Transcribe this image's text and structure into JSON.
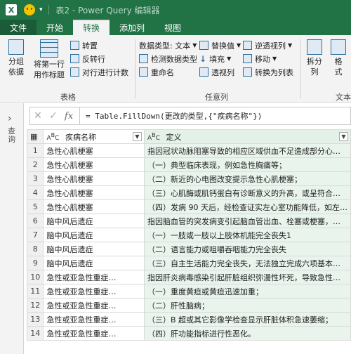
{
  "titlebar": {
    "logo": "X",
    "title": "表2 - Power Query 编辑器"
  },
  "tabs": [
    "文件",
    "开始",
    "转换",
    "添加列",
    "视图"
  ],
  "ribbon": {
    "group_table": {
      "label": "表格",
      "group_by": "分组\n依据",
      "first_row_header": "将第一行\n用作标题",
      "transpose": "转置",
      "reverse_rows": "反转行",
      "count_rows": "对行进行计数"
    },
    "group_anycol": {
      "label": "任意列",
      "data_type": "数据类型: 文本",
      "detect_type": "检测数据类型",
      "rename": "重命名",
      "replace_values": "替换值",
      "fill": "填充",
      "pivot": "透视列",
      "unpivot": "逆透视列",
      "move": "移动",
      "to_list": "转换为列表"
    },
    "split": "拆分\n列",
    "format": "格\n式",
    "text_label": "文本"
  },
  "leftpane": {
    "label": "查询"
  },
  "formula": {
    "text": "= Table.FillDown(更改的类型,{\"疾病名称\"})"
  },
  "columns": [
    "疾病名称",
    "定义"
  ],
  "rows": [
    [
      "1",
      "急性心肌梗塞",
      "指因冠状动脉阻塞导致的相应区域供血不足造成部分心…"
    ],
    [
      "2",
      "急性心肌梗塞",
      "（一）典型临床表现，例如急性胸痛等；"
    ],
    [
      "3",
      "急性心肌梗塞",
      "（二）新近的心电图改变提示急性心肌梗塞；"
    ],
    [
      "4",
      "急性心肌梗塞",
      "（三）心肌酶或肌钙蛋白有诊断意义的升高，或呈符合…"
    ],
    [
      "5",
      "急性心肌梗塞",
      "（四）发病 90 天后，经检查证实左心室功能降低，如左…"
    ],
    [
      "6",
      "脑中风后遗症",
      "指因脑血管的突发病变引起脑血管出血、栓塞或梗塞，…"
    ],
    [
      "7",
      "脑中风后遗症",
      "（一）一肢或一肢以上肢体机能完全丧失1"
    ],
    [
      "8",
      "脑中风后遗症",
      "（二）语言能力或咀嚼吞咽能力完全丧失"
    ],
    [
      "9",
      "脑中风后遗症",
      "（三）自主生活能力完全丧失，无法独立完成六项基本…"
    ],
    [
      "10",
      "急性或亚急性重症…",
      "指因肝炎病毒感染引起肝脏组织弥漫性坏死，导致急性…"
    ],
    [
      "11",
      "急性或亚急性重症…",
      "（一）重度黄疸或黄疸迅速加重；"
    ],
    [
      "12",
      "急性或亚急性重症…",
      "（二）肝性脑病；"
    ],
    [
      "13",
      "急性或亚急性重症…",
      "（三）B 超或其它影像学检查显示肝脏体积急速萎缩；"
    ],
    [
      "14",
      "急性或亚急性重症…",
      "（四）肝功能指标进行性恶化。"
    ]
  ],
  "colors": {
    "excel_green": "#217346",
    "selected_col": "#e9f4ed"
  }
}
